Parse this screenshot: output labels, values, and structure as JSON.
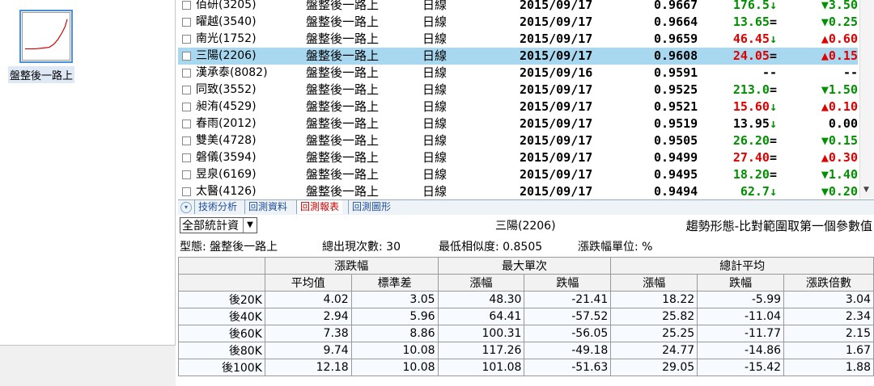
{
  "sidebar": {
    "pattern_name": "盤整後一路上"
  },
  "stocks": [
    {
      "name": "佰研(3205)",
      "pattern": "盤整後一路上",
      "period": "日線",
      "date": "2015/09/17",
      "similarity": "0.9667",
      "price": "176.5",
      "price_dir": "down",
      "price_sign": "↓",
      "change": "3.50",
      "change_dir": "down",
      "change_sign": "▼",
      "selected": false
    },
    {
      "name": "曜越(3540)",
      "pattern": "盤整後一路上",
      "period": "日線",
      "date": "2015/09/17",
      "similarity": "0.9664",
      "price": "13.65",
      "price_dir": "down",
      "price_sign": "=",
      "change": "0.25",
      "change_dir": "down",
      "change_sign": "▼",
      "selected": false
    },
    {
      "name": "南光(1752)",
      "pattern": "盤整後一路上",
      "period": "日線",
      "date": "2015/09/17",
      "similarity": "0.9659",
      "price": "46.45",
      "price_dir": "up",
      "price_sign": "↓",
      "change": "0.60",
      "change_dir": "up",
      "change_sign": "▲",
      "selected": false
    },
    {
      "name": "三陽(2206)",
      "pattern": "盤整後一路上",
      "period": "日線",
      "date": "2015/09/17",
      "similarity": "0.9608",
      "price": "24.05",
      "price_dir": "up",
      "price_sign": "=",
      "change": "0.15",
      "change_dir": "up",
      "change_sign": "▲",
      "selected": true
    },
    {
      "name": "漢承泰(8082)",
      "pattern": "盤整後一路上",
      "period": "日線",
      "date": "2015/09/16",
      "similarity": "0.9591",
      "price": "--",
      "price_dir": "flat",
      "price_sign": "",
      "change": "--",
      "change_dir": "flat",
      "change_sign": "",
      "selected": false
    },
    {
      "name": "同致(3552)",
      "pattern": "盤整後一路上",
      "period": "日線",
      "date": "2015/09/17",
      "similarity": "0.9525",
      "price": "213.0",
      "price_dir": "down",
      "price_sign": "=",
      "change": "1.50",
      "change_dir": "down",
      "change_sign": "▼",
      "selected": false
    },
    {
      "name": "昶洧(4529)",
      "pattern": "盤整後一路上",
      "period": "日線",
      "date": "2015/09/17",
      "similarity": "0.9521",
      "price": "15.60",
      "price_dir": "up",
      "price_sign": "↓",
      "change": "0.10",
      "change_dir": "up",
      "change_sign": "▲",
      "selected": false
    },
    {
      "name": "春雨(2012)",
      "pattern": "盤整後一路上",
      "period": "日線",
      "date": "2015/09/17",
      "similarity": "0.9519",
      "price": "13.95",
      "price_dir": "flat",
      "price_sign": "↓",
      "change": "0.00",
      "change_dir": "flat",
      "change_sign": "",
      "selected": false
    },
    {
      "name": "雙美(4728)",
      "pattern": "盤整後一路上",
      "period": "日線",
      "date": "2015/09/17",
      "similarity": "0.9505",
      "price": "26.20",
      "price_dir": "down",
      "price_sign": "=",
      "change": "0.15",
      "change_dir": "down",
      "change_sign": "▼",
      "selected": false
    },
    {
      "name": "磐儀(3594)",
      "pattern": "盤整後一路上",
      "period": "日線",
      "date": "2015/09/17",
      "similarity": "0.9499",
      "price": "27.40",
      "price_dir": "up",
      "price_sign": "=",
      "change": "0.30",
      "change_dir": "up",
      "change_sign": "▲",
      "selected": false
    },
    {
      "name": "昱泉(6169)",
      "pattern": "盤整後一路上",
      "period": "日線",
      "date": "2015/09/17",
      "similarity": "0.9495",
      "price": "18.20",
      "price_dir": "down",
      "price_sign": "=",
      "change": "1.40",
      "change_dir": "down",
      "change_sign": "▼",
      "selected": false
    },
    {
      "name": "太醫(4126)",
      "pattern": "盤整後一路上",
      "period": "日線",
      "date": "2015/09/17",
      "similarity": "0.9494",
      "price": "62.7",
      "price_dir": "down",
      "price_sign": "↓",
      "change": "0.20",
      "change_dir": "down",
      "change_sign": "▼",
      "selected": false
    }
  ],
  "tabs": [
    {
      "label": "技術分析",
      "active": false
    },
    {
      "label": "回測資料",
      "active": false
    },
    {
      "label": "回測報表",
      "active": true
    },
    {
      "label": "回測圖形",
      "active": false
    }
  ],
  "report": {
    "stat_select": "全部統計資",
    "stock": "三陽(2206)",
    "method": "趨勢形態-比對範圍取第一個參數值",
    "pattern_label": "型態: 盤整後一路上",
    "occurrences_label": "總出現次數: 30",
    "min_similarity_label": "最低相似度: 0.8505",
    "unit_label": "漲跌幅單位: %",
    "group_headers": [
      "漲跌幅",
      "最大單次",
      "總計平均"
    ],
    "sub_headers": [
      "平均值",
      "標準差",
      "漲幅",
      "跌幅",
      "漲幅",
      "跌幅",
      "漲跌倍數"
    ],
    "rows": [
      {
        "label": "後20K",
        "cells": [
          "4.02",
          "3.05",
          "48.30",
          "-21.41",
          "18.22",
          "-5.99",
          "3.04"
        ]
      },
      {
        "label": "後40K",
        "cells": [
          "2.94",
          "5.96",
          "64.41",
          "-57.52",
          "25.82",
          "-11.04",
          "2.34"
        ]
      },
      {
        "label": "後60K",
        "cells": [
          "7.38",
          "8.86",
          "100.31",
          "-56.05",
          "25.25",
          "-11.77",
          "2.15"
        ]
      },
      {
        "label": "後80K",
        "cells": [
          "9.74",
          "10.08",
          "117.26",
          "-49.18",
          "24.77",
          "-14.86",
          "1.67"
        ]
      },
      {
        "label": "後100K",
        "cells": [
          "12.18",
          "10.08",
          "101.08",
          "-51.63",
          "29.05",
          "-15.42",
          "1.88"
        ]
      }
    ]
  },
  "colors": {
    "up": "#e00000",
    "down": "#009000",
    "selected_row": "#a8d8f0",
    "active_tab": "#d00000"
  }
}
